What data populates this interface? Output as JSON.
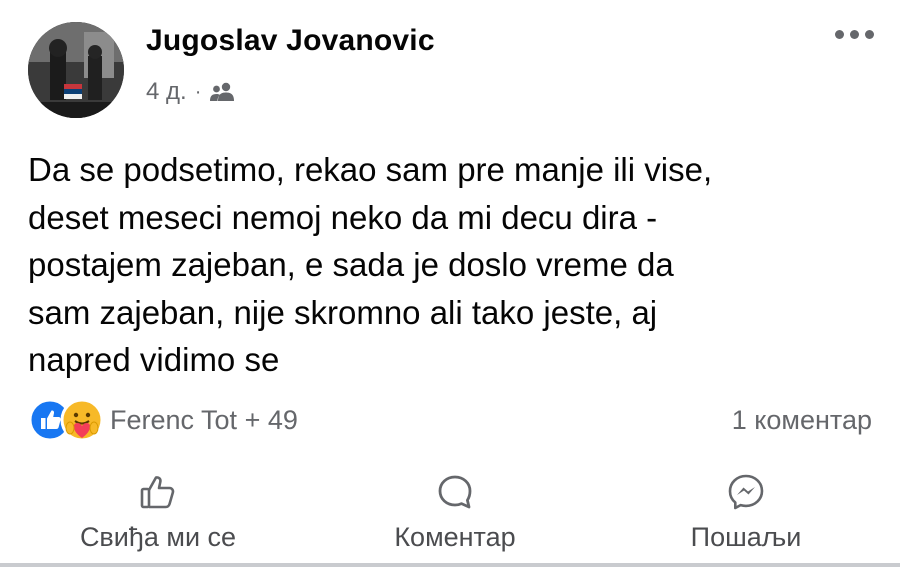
{
  "post": {
    "author": "Jugoslav Jovanovic",
    "time": "4 д.",
    "separator": "·",
    "audience_icon": "friends-icon",
    "text": "Da se podsetimo, rekao sam pre manje ili vise,\ndeset meseci nemoj neko da mi decu dira -\npostajem zajeban, e sada je doslo vreme da\nsam zajeban, nije skromno ali tako jeste, aj\nnapred vidimo se",
    "reactions": {
      "icons": [
        "like-icon",
        "care-icon"
      ],
      "names": "Ferenc Tot + 49"
    },
    "comments_count": "1 коментар",
    "actions": {
      "like": "Свиђа ми се",
      "comment": "Коментар",
      "share": "Пошаљи"
    }
  },
  "colors": {
    "text": "#050505",
    "secondary": "#65676b",
    "like_blue": "#1877f2",
    "care_yellow": "#f7b928",
    "care_red": "#f33e58"
  }
}
